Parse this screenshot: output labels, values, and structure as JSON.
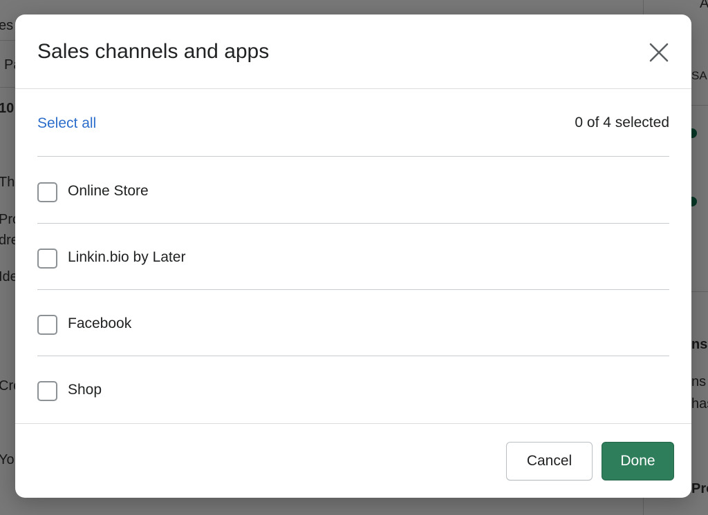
{
  "modal": {
    "title": "Sales channels and apps",
    "select_all_label": "Select all",
    "selection_count": "0 of 4 selected",
    "options": [
      {
        "label": "Online Store",
        "checked": false
      },
      {
        "label": "Linkin.bio by Later",
        "checked": false
      },
      {
        "label": "Facebook",
        "checked": false
      },
      {
        "label": "Shop",
        "checked": false
      }
    ],
    "cancel_label": "Cancel",
    "done_label": "Done"
  },
  "background": {
    "fragments": [
      "es",
      "Pa",
      "10",
      "Th",
      "Pro",
      "dre",
      "Ide",
      "Cre",
      "Yo",
      "A",
      "SAL",
      "ns",
      "ns",
      "has",
      "Pro"
    ]
  },
  "colors": {
    "accent_link": "#2c6ecb",
    "primary_button": "#2e7d5b",
    "status_dot": "#0b6e4f"
  },
  "icons": {
    "close": "close-icon",
    "checkbox": "checkbox-icon"
  }
}
